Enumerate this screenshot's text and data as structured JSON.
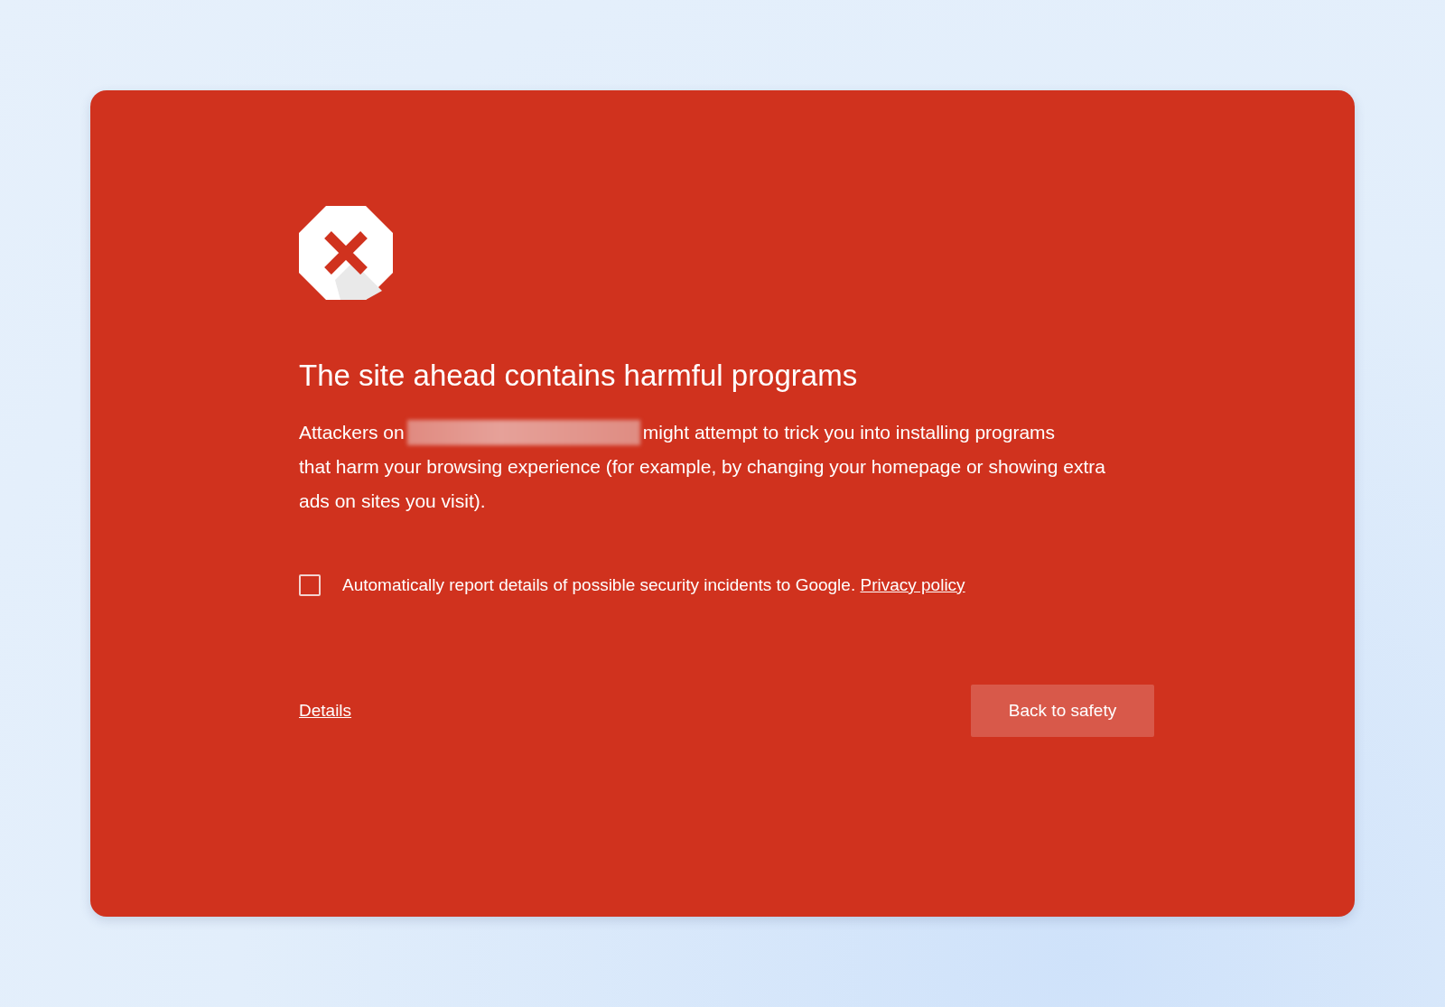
{
  "warning": {
    "title": "The site ahead contains harmful programs",
    "body": {
      "lead": "Attackers on",
      "line_1_rest": "might attempt to trick you into installing programs",
      "continuation": "that harm your browsing experience (for example, by changing your homepage or showing extra ads on sites you visit)."
    },
    "report_option": {
      "label": "Automatically report details of possible security incidents to Google.",
      "link": "Privacy policy",
      "checked": false
    },
    "details_link": "Details",
    "back_button": "Back to safety"
  }
}
